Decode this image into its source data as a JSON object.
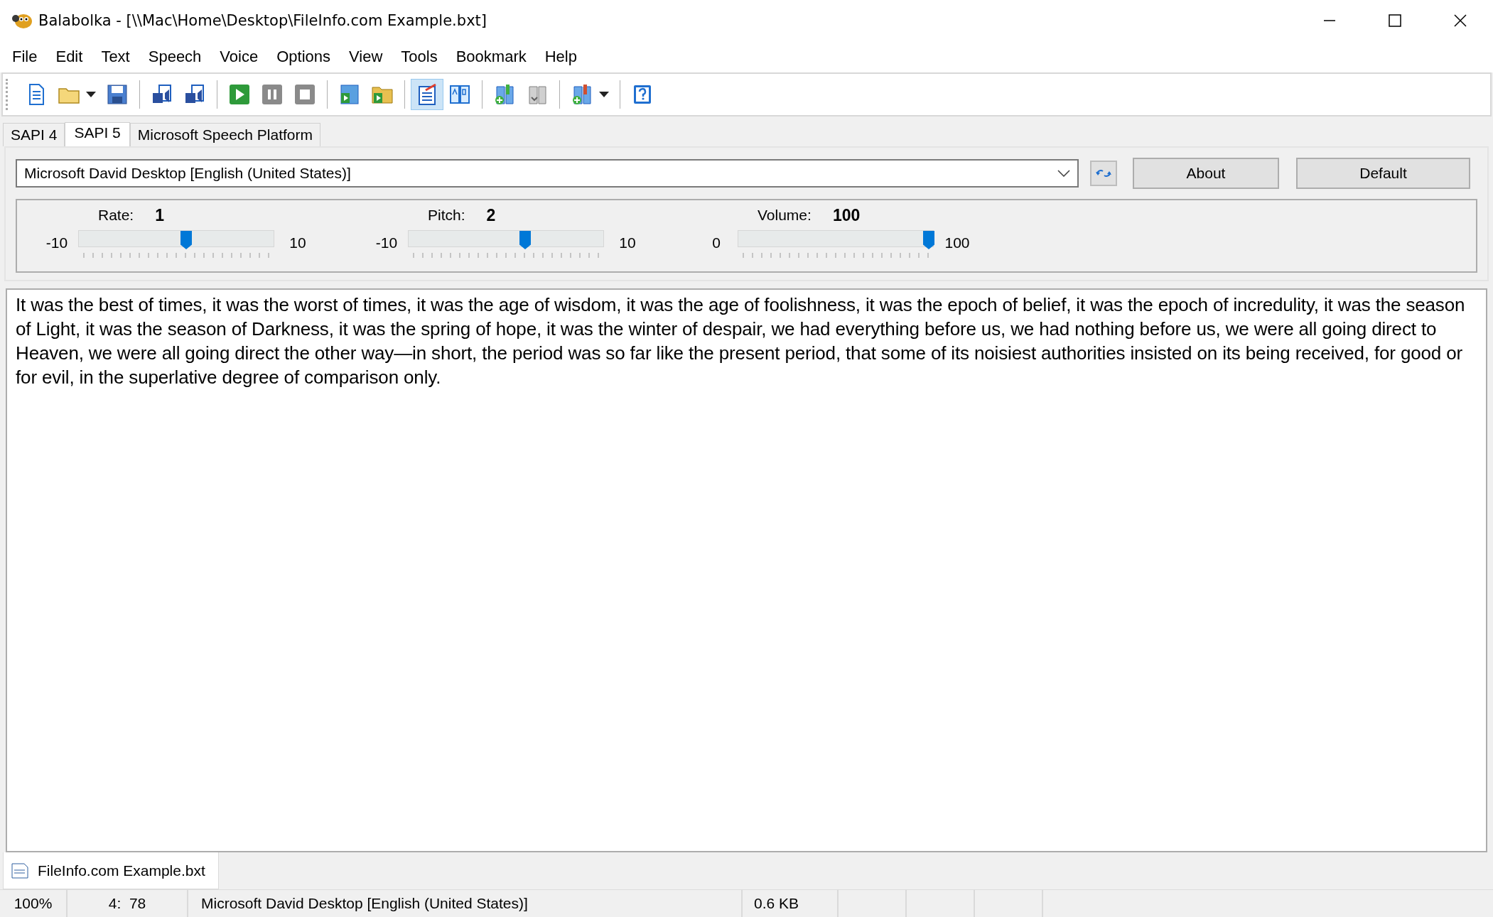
{
  "window": {
    "title": "Balabolka - [\\\\Mac\\Home\\Desktop\\FileInfo.com Example.bxt]"
  },
  "menu": [
    "File",
    "Edit",
    "Text",
    "Speech",
    "Voice",
    "Options",
    "View",
    "Tools",
    "Bookmark",
    "Help"
  ],
  "toolbar": {
    "groups": [
      [
        {
          "kind": "page",
          "on": false,
          "dropdown": false
        },
        {
          "kind": "folder",
          "on": false,
          "dropdown": true
        },
        {
          "kind": "floppy",
          "on": false,
          "dropdown": false
        }
      ],
      [
        {
          "kind": "page-speaker",
          "on": false,
          "dropdown": false
        },
        {
          "kind": "pages-speaker",
          "on": false,
          "dropdown": false
        }
      ],
      [
        {
          "kind": "play",
          "on": false,
          "dropdown": false
        },
        {
          "kind": "pause",
          "on": false,
          "dropdown": false
        },
        {
          "kind": "stop",
          "on": false,
          "dropdown": false
        }
      ],
      [
        {
          "kind": "book-play",
          "on": false,
          "dropdown": false
        },
        {
          "kind": "folder-play",
          "on": false,
          "dropdown": false
        }
      ],
      [
        {
          "kind": "page-pen",
          "on": true,
          "dropdown": false
        },
        {
          "kind": "book-letters",
          "on": false,
          "dropdown": false
        }
      ],
      [
        {
          "kind": "book-plus",
          "on": false,
          "dropdown": false
        },
        {
          "kind": "book-grey",
          "on": false,
          "dropdown": false
        }
      ],
      [
        {
          "kind": "book-plus-red",
          "on": false,
          "dropdown": true
        }
      ],
      [
        {
          "kind": "help",
          "on": false,
          "dropdown": false
        }
      ]
    ]
  },
  "engine_tabs": [
    {
      "label": "SAPI 4",
      "selected": false
    },
    {
      "label": "SAPI 5",
      "selected": true
    },
    {
      "label": "Microsoft Speech Platform",
      "selected": false
    }
  ],
  "voice_select": {
    "value": "Microsoft David Desktop [English (United States)]"
  },
  "buttons": [
    "About",
    "Default"
  ],
  "sliders": [
    {
      "label": "Rate:",
      "value": "1",
      "min": "-10",
      "max": "10",
      "level": 0.55
    },
    {
      "label": "Pitch:",
      "value": "2",
      "min": "-10",
      "max": "10",
      "level": 0.6
    },
    {
      "label": "Volume:",
      "value": "100",
      "min": "0",
      "max": "100",
      "level": 1.0
    }
  ],
  "editor": {
    "text": "It was the best of times, it was the worst of times, it was the age of wisdom, it was the age of foolishness, it was the epoch of belief, it was the epoch of incredulity, it was the season of Light, it was the season of Darkness, it was the spring of hope, it was the winter of despair, we had everything before us, we had nothing before us, we were all going direct to Heaven, we were all going direct the other way—in short, the period was so far like the present period, that some of its noisiest authorities insisted on its being received, for good or for evil, in the superlative degree of comparison only."
  },
  "document_tabs": [
    {
      "label": "FileInfo.com Example.bxt",
      "selected": true
    }
  ],
  "status_bar": {
    "zoom": "100%",
    "position": "4:  78",
    "voice": "Microsoft David Desktop [English (United States)]",
    "size": "0.6 KB"
  }
}
